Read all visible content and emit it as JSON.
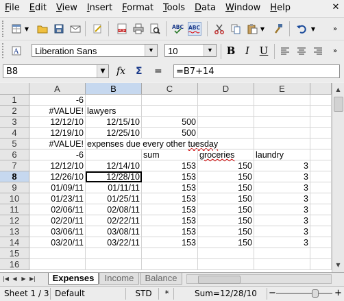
{
  "menu": {
    "items": [
      "File",
      "Edit",
      "View",
      "Insert",
      "Format",
      "Tools",
      "Data",
      "Window",
      "Help"
    ],
    "close_glyph": "✕"
  },
  "toolbar_standard": {
    "icons": [
      "new-doc-icon",
      "open-folder-icon",
      "save-icon",
      "email-icon",
      "edit-file-icon",
      "export-pdf-icon",
      "print-icon",
      "print-preview-icon",
      "spellcheck-icon",
      "autospellcheck-icon",
      "cut-icon",
      "copy-icon",
      "paste-icon",
      "format-paintbrush-icon",
      "undo-icon"
    ]
  },
  "toolbar_formatting": {
    "font_name": "Liberation Sans",
    "font_size": "10",
    "bold": "B",
    "italic": "I",
    "underline": "U"
  },
  "formula_bar": {
    "cell_ref": "B8",
    "formula": "=B7+14",
    "fx": "fx",
    "sum": "Σ",
    "equals": "="
  },
  "columns": [
    "A",
    "B",
    "C",
    "D",
    "E"
  ],
  "selected_column": "B",
  "selected_row": "8",
  "rows": [
    {
      "n": "1",
      "A": "-6",
      "B": "",
      "C": "",
      "D": "",
      "E": ""
    },
    {
      "n": "2",
      "A": "#VALUE!",
      "B": "lawyers",
      "C": "",
      "D": "",
      "E": ""
    },
    {
      "n": "3",
      "A": "12/12/10",
      "B": "12/15/10",
      "C": "500",
      "D": "",
      "E": ""
    },
    {
      "n": "4",
      "A": "12/19/10",
      "B": "12/25/10",
      "C": "500",
      "D": "",
      "E": ""
    },
    {
      "n": "5",
      "A": "#VALUE!",
      "B": "expenses due every other tuesday",
      "C": "",
      "D": "",
      "E": ""
    },
    {
      "n": "6",
      "A": "-6",
      "B": "",
      "C": "sum",
      "D": "groceries",
      "E": "laundry"
    },
    {
      "n": "7",
      "A": "12/12/10",
      "B": "12/14/10",
      "C": "153",
      "D": "150",
      "E": "3"
    },
    {
      "n": "8",
      "A": "12/26/10",
      "B": "12/28/10",
      "C": "153",
      "D": "150",
      "E": "3"
    },
    {
      "n": "9",
      "A": "01/09/11",
      "B": "01/11/11",
      "C": "153",
      "D": "150",
      "E": "3"
    },
    {
      "n": "10",
      "A": "01/23/11",
      "B": "01/25/11",
      "C": "153",
      "D": "150",
      "E": "3"
    },
    {
      "n": "11",
      "A": "02/06/11",
      "B": "02/08/11",
      "C": "153",
      "D": "150",
      "E": "3"
    },
    {
      "n": "12",
      "A": "02/20/11",
      "B": "02/22/11",
      "C": "153",
      "D": "150",
      "E": "3"
    },
    {
      "n": "13",
      "A": "03/06/11",
      "B": "03/08/11",
      "C": "153",
      "D": "150",
      "E": "3"
    },
    {
      "n": "14",
      "A": "03/20/11",
      "B": "03/22/11",
      "C": "153",
      "D": "150",
      "E": "3"
    },
    {
      "n": "15",
      "A": "",
      "B": "",
      "C": "",
      "D": "",
      "E": ""
    },
    {
      "n": "16",
      "A": "",
      "B": "",
      "C": "",
      "D": "",
      "E": ""
    }
  ],
  "sheet_tabs": [
    "Expenses",
    "Income",
    "Balance"
  ],
  "active_sheet": "Expenses",
  "status": {
    "sheet": "Sheet 1 / 3",
    "style": "Default",
    "mode": "STD",
    "modified": "*",
    "sum": "Sum=12/28/10",
    "zoom_minus": "−",
    "zoom_plus": "+"
  }
}
